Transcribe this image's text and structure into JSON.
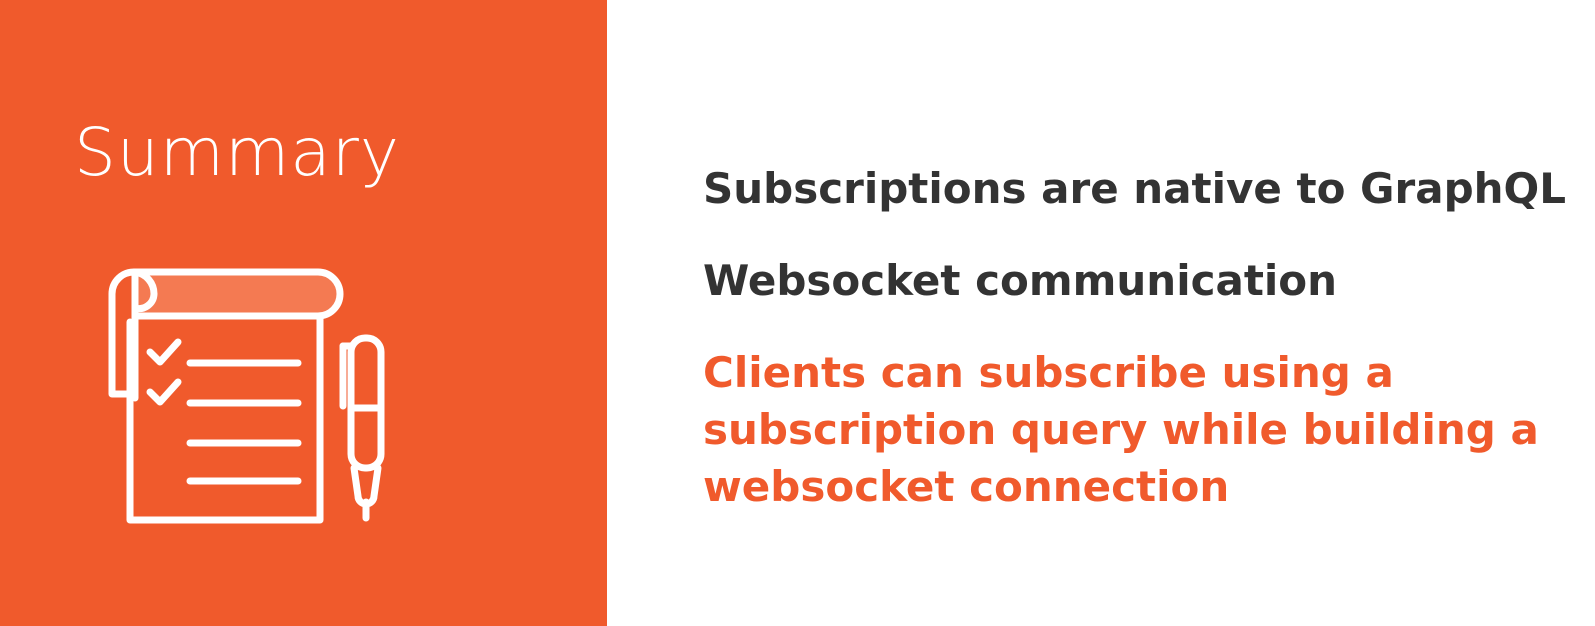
{
  "colors": {
    "accent": "#f05a2c",
    "text_dark": "#333333",
    "background": "#ffffff",
    "icon_stroke": "#ffffff",
    "icon_fill_light": "#f47a52"
  },
  "sidebar": {
    "title": "Summary",
    "icon": "checklist-and-pen-icon"
  },
  "bullets": [
    {
      "text": "Subscriptions are native to GraphQL",
      "style": "dark"
    },
    {
      "text": "Websocket communication",
      "style": "dark"
    },
    {
      "style": "accent",
      "lines": [
        "Clients can subscribe using a",
        "subscription query while building a",
        "websocket connection"
      ]
    }
  ]
}
